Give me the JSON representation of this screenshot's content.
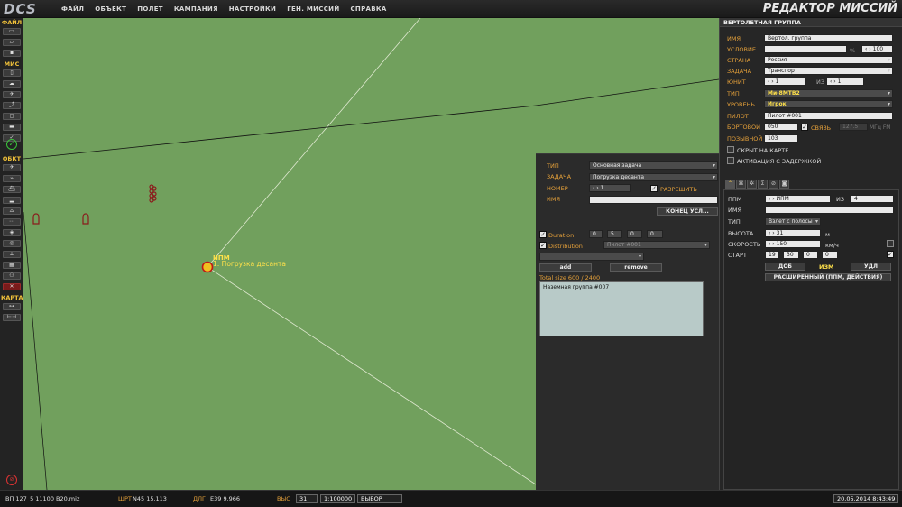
{
  "app": {
    "logo": "DCS",
    "title": "РЕДАКТОР МИССИЙ",
    "menu": [
      "ФАЙЛ",
      "ОБЪЕКТ",
      "ПОЛЕТ",
      "КАМПАНИЯ",
      "НАСТРОЙКИ",
      "ГЕН. МИССИЙ",
      "СПРАВКА"
    ]
  },
  "toolbar": {
    "file_header": "ФАЙЛ",
    "mis_header": "МИС",
    "obj_header": "ОБКТ",
    "map_header": "КАРТА"
  },
  "map": {
    "waypoint_label": "ИПМ",
    "waypoint_action": "1: Погрузка десанта"
  },
  "trigger": {
    "type_label": "ТИП",
    "type_value": "Основная задача",
    "task_label": "ЗАДАЧА",
    "task_value": "Погрузка десанта",
    "number_label": "НОМЕР",
    "number_value": "1",
    "allow_label": "РАЗРЕШИТЬ",
    "name_label": "ИМЯ",
    "name_value": "",
    "end_cond_button": "КОНЕЦ УСЛ...",
    "duration_label": "Duration",
    "duration_values": [
      "0",
      "5",
      "0",
      "0"
    ],
    "distribution_label": "Distribution",
    "distribution_value": "Пилот #001",
    "extra_value": "",
    "add_button": "add",
    "remove_button": "remove",
    "total_size": "Total size 600 / 2400",
    "list_item": "Наземная группа #007"
  },
  "group": {
    "header": "ВЕРТОЛЕТНАЯ ГРУППА",
    "name_label": "ИМЯ",
    "name_value": "Вертол. группа",
    "condition_label": "УСЛОВИЕ",
    "condition_value": "",
    "condition_pct": "%",
    "condition_num": "100",
    "country_label": "СТРАНА",
    "country_value": "Россия",
    "task_label": "ЗАДАЧА",
    "task_value": "Транспорт",
    "unit_label": "ЮНИТ",
    "unit_value": "1",
    "unit_of": "ИЗ",
    "unit_total": "1",
    "type_label": "ТИП",
    "type_value": "Ми-8МТВ2",
    "level_label": "УРОВЕНЬ",
    "level_value": "Игрок",
    "pilot_label": "ПИЛОТ",
    "pilot_value": "Пилот #001",
    "board_label": "БОРТОВОЙ",
    "board_value": "050",
    "comm_label": "СВЯЗЬ",
    "freq_value": "127.5",
    "freq_unit": "МГц FM",
    "callsign_label": "ПОЗЫВНОЙ",
    "callsign_value": "103",
    "hidden_label": "СКРЫТ НА КАРТЕ",
    "delayed_label": "АКТИВАЦИЯ С ЗАДЕРЖКОЙ"
  },
  "waypoint": {
    "ppm_label": "ППМ",
    "ppm_value": "ИПМ",
    "ppm_of": "ИЗ",
    "ppm_total": "4",
    "name_label": "ИМЯ",
    "name_value": "",
    "type_label": "ТИП",
    "type_value": "Взлет с полосы",
    "alt_label": "ВЫСОТА",
    "alt_value": "31",
    "alt_unit": "м",
    "speed_label": "СКОРОСТЬ",
    "speed_value": "150",
    "speed_unit": "км/ч",
    "start_label": "СТАРТ",
    "start_values": [
      "19",
      "30",
      "0",
      "0"
    ],
    "add_button": "ДОБ",
    "edit_button": "ИЗМ",
    "del_button": "УДЛ",
    "advanced_button": "РАСШИРЕННЫЙ (ППМ, ДЕЙСТВИЯ)"
  },
  "status": {
    "file": "ВП 127_5 11100 В20.miz",
    "lat_label": "ШРТ",
    "lat_value": "N45 15.113",
    "lon_label": "ДЛГ",
    "lon_value": "E39  9.966",
    "alt_label": "ВЫС",
    "alt_value": "31",
    "scale": "1:100000",
    "mode": "ВЫБОР",
    "datetime": "20.05.2014 8:43:49"
  },
  "colors": {
    "map_green": "#71a05d",
    "accent_orange": "#e6a13a",
    "highlight_yellow": "#ffe14a"
  }
}
